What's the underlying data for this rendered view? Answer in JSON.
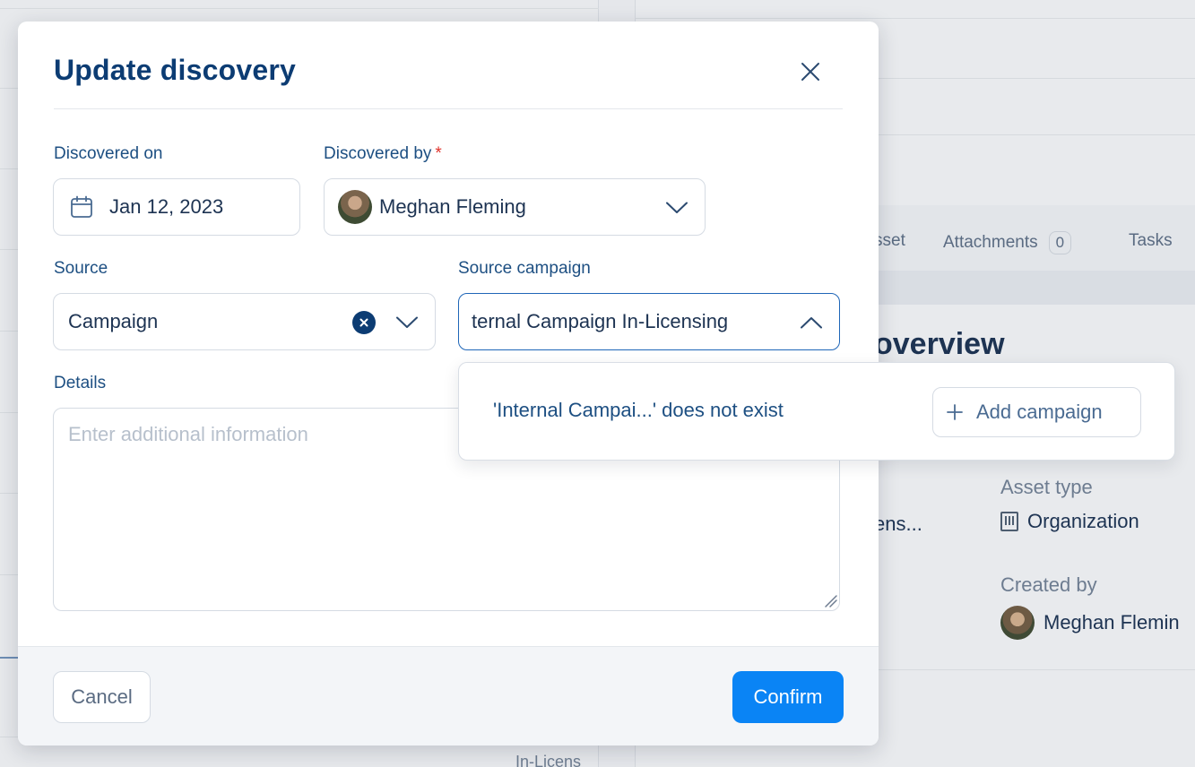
{
  "background": {
    "tabs": [
      {
        "label": "sset"
      },
      {
        "label": "Attachments",
        "count": "0"
      },
      {
        "label": "Tasks"
      }
    ],
    "overview_heading": "overview",
    "truncated_value": "ens...",
    "asset_type_label": "Asset type",
    "asset_type_value": "Organization",
    "created_by_label": "Created by",
    "created_by_value": "Meghan Flemin",
    "left_footer_text": "In-Licens"
  },
  "modal": {
    "title": "Update discovery",
    "discovered_on": {
      "label": "Discovered on",
      "value": "Jan 12, 2023"
    },
    "discovered_by": {
      "label": "Discovered by",
      "required_mark": "*",
      "value": "Meghan Fleming"
    },
    "source": {
      "label": "Source",
      "value": "Campaign"
    },
    "source_campaign": {
      "label": "Source campaign",
      "value": "ternal Campaign In-Licensing"
    },
    "details": {
      "label": "Details",
      "placeholder": "Enter additional information"
    },
    "footer": {
      "cancel_label": "Cancel",
      "confirm_label": "Confirm"
    }
  },
  "dropdown": {
    "message": "'Internal Campai...' does not exist",
    "add_label": "Add campaign"
  },
  "colors": {
    "primary_text": "#0c3c73",
    "confirm_bg": "#0a84f5",
    "focus_border": "#1f66b8",
    "required": "#e0332b"
  }
}
